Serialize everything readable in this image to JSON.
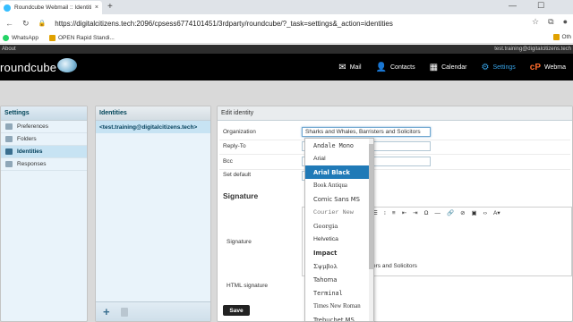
{
  "browser": {
    "tab_title": "Roundcube Webmail :: Identities",
    "tab_close": "×",
    "new_tab": "+",
    "win_min": "—",
    "win_max": "☐",
    "url": "https://digitalcitizens.tech:2096/cpsess6774101451/3rdparty/roundcube/?_task=settings&_action=identities",
    "bookmarks": [
      {
        "label": "WhatsApp",
        "color": "#25d366"
      },
      {
        "label": "OPEN Rapid Standi...",
        "color": "#e0a100"
      }
    ],
    "bookmark_other": "Oth"
  },
  "app": {
    "about": "About",
    "user": "test.training@digitalcitizens.tech",
    "logo": "roundcube",
    "nav": [
      {
        "label": "Mail",
        "icon": "✉",
        "active": false
      },
      {
        "label": "Contacts",
        "icon": "👤",
        "active": false
      },
      {
        "label": "Calendar",
        "icon": "▦",
        "active": false
      },
      {
        "label": "Settings",
        "icon": "⚙",
        "active": true
      },
      {
        "label": "Webma",
        "icon": "cP",
        "active": false
      }
    ]
  },
  "settings": {
    "title": "Settings",
    "items": [
      {
        "label": "Preferences",
        "selected": false
      },
      {
        "label": "Folders",
        "selected": false
      },
      {
        "label": "Identities",
        "selected": true
      },
      {
        "label": "Responses",
        "selected": false
      }
    ]
  },
  "identities": {
    "title": "Identities",
    "items": [
      "<test.training@digitalcitizens.tech>"
    ]
  },
  "edit": {
    "title": "Edit identity",
    "organization_label": "Organization",
    "organization_value": "Sharks and Whales, Barristers and Solicitors",
    "replyto_label": "Reply-To",
    "bcc_label": "Bcc",
    "setdefault_label": "Set default",
    "signature_title": "Signature",
    "signature_label": "Signature",
    "html_signature_label": "HTML signature",
    "signature_text_partial": "ers and Solicitors",
    "save": "Save"
  },
  "font_dropdown": {
    "options": [
      {
        "label": "Andale Mono",
        "highlight": false
      },
      {
        "label": "Arial",
        "highlight": false
      },
      {
        "label": "Arial Black",
        "highlight": true
      },
      {
        "label": "Book Antiqua",
        "highlight": false
      },
      {
        "label": "Comic Sans MS",
        "highlight": false
      },
      {
        "label": "Courier New",
        "highlight": false
      },
      {
        "label": "Georgia",
        "highlight": false
      },
      {
        "label": "Helvetica",
        "highlight": false
      },
      {
        "label": "Impact",
        "highlight": false
      },
      {
        "label": "Σψμβολ",
        "highlight": false
      },
      {
        "label": "Tahoma",
        "highlight": false
      },
      {
        "label": "Terminal",
        "highlight": false
      },
      {
        "label": "Times New Roman",
        "highlight": false
      },
      {
        "label": "Trebuchet MS",
        "highlight": false
      }
    ]
  },
  "colors": {
    "accent": "#37a2e6",
    "highlight": "#207ab7",
    "header_bg": "#000000"
  }
}
